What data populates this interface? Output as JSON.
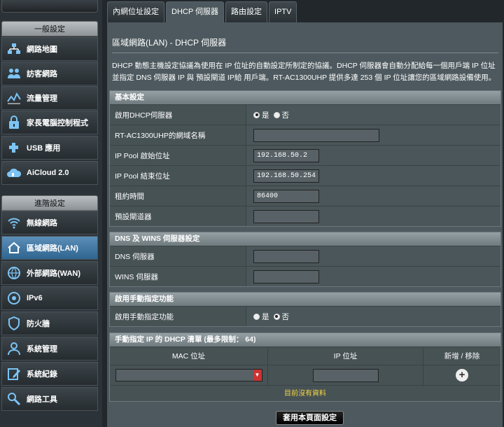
{
  "sidebar": {
    "general_header": "一般設定",
    "general_items": [
      {
        "label": "網路地圖",
        "icon": "network-map-icon"
      },
      {
        "label": "訪客網路",
        "icon": "guest-network-icon"
      },
      {
        "label": "流量管理",
        "icon": "traffic-manager-icon"
      },
      {
        "label": "家長電腦控制程式",
        "icon": "parental-control-icon"
      },
      {
        "label": "USB 應用",
        "icon": "usb-application-icon"
      },
      {
        "label": "AiCloud 2.0",
        "icon": "aicloud-icon"
      }
    ],
    "advanced_header": "進階設定",
    "advanced_items": [
      {
        "label": "無線網路",
        "icon": "wireless-icon"
      },
      {
        "label": "區域網路(LAN)",
        "icon": "lan-icon",
        "active": true
      },
      {
        "label": "外部網路(WAN)",
        "icon": "wan-icon"
      },
      {
        "label": "IPv6",
        "icon": "ipv6-icon"
      },
      {
        "label": "防火牆",
        "icon": "firewall-icon"
      },
      {
        "label": "系統管理",
        "icon": "administration-icon"
      },
      {
        "label": "系統紀錄",
        "icon": "system-log-icon"
      },
      {
        "label": "網路工具",
        "icon": "network-tools-icon"
      }
    ]
  },
  "tabs": [
    "內網位址設定",
    "DHCP 伺服器",
    "路由設定",
    "IPTV"
  ],
  "active_tab": 1,
  "page": {
    "title": "區域網路(LAN) - DHCP 伺服器",
    "description": "DHCP 動態主機設定協議為使用在 IP 位址的自動設定所制定的協議。DHCP 伺服器會自動分配給每一個用戶端 IP 位址並指定 DNS 伺服器 IP 與 預設閘道 IP給 用戶端。RT-AC1300UHP 提供多達 253 個 IP 位址讓您的區域網路設備使用。"
  },
  "basic": {
    "header": "基本設定",
    "enable_dhcp_label": "啟用DHCP伺服器",
    "yes": "是",
    "no": "否",
    "enable_dhcp_value": "是",
    "domain_name_label": "RT-AC1300UHP的網域名稱",
    "domain_name_value": "",
    "pool_start_label": "IP Pool 啟始位址",
    "pool_start_value": "192.168.50.2",
    "pool_end_label": "IP Pool 結束位址",
    "pool_end_value": "192.168.50.254",
    "lease_label": "租約時間",
    "lease_value": "86400",
    "gateway_label": "預設閘道器",
    "gateway_value": ""
  },
  "dns": {
    "header": "DNS 及 WINS 伺服器設定",
    "dns_label": "DNS 伺服器",
    "dns_value": "",
    "wins_label": "WINS 伺服器",
    "wins_value": ""
  },
  "manual": {
    "header": "啟用手動指定功能",
    "enable_label": "啟用手動指定功能",
    "yes": "是",
    "no": "否",
    "enable_value": "否"
  },
  "list": {
    "header": "手動指定 IP 的 DHCP 清單 (最多限制： 64)",
    "col_mac": "MAC 位址",
    "col_ip": "IP 位址",
    "col_action": "新增 / 移除",
    "add_symbol": "+",
    "empty_text": "目前沒有資料"
  },
  "apply_label": "套用本頁面設定",
  "colors": {
    "accent": "#5c8fb8",
    "empty_text": "#f5d542",
    "background": "#4d595e"
  }
}
